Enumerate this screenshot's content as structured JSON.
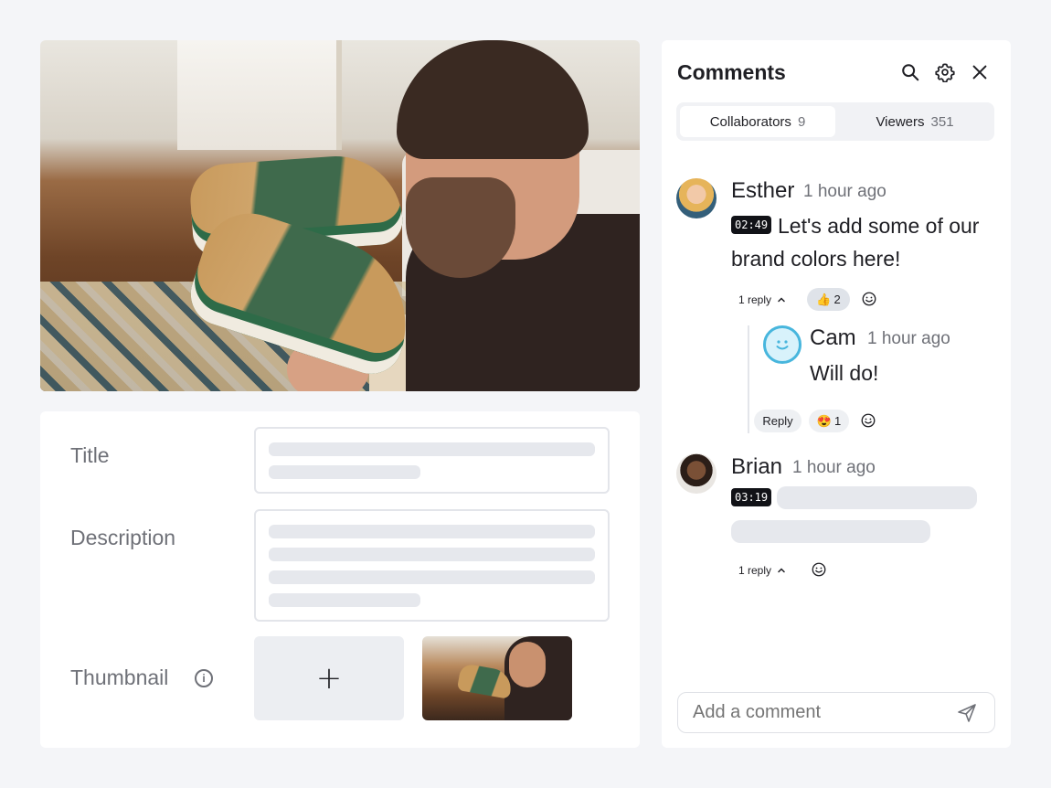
{
  "form": {
    "title_label": "Title",
    "description_label": "Description",
    "thumbnail_label": "Thumbnail",
    "add_thumbnail_symbol": "+",
    "info_symbol": "i"
  },
  "comments_panel": {
    "title": "Comments",
    "icons": [
      "search-icon",
      "gear-icon",
      "close-icon"
    ],
    "tabs": [
      {
        "label": "Collaborators",
        "count": "9",
        "active": true
      },
      {
        "label": "Viewers",
        "count": "351",
        "active": false
      }
    ],
    "comments": [
      {
        "author": "Esther",
        "time": "1 hour ago",
        "timestamp": "02:49",
        "text": "Let's add some of our brand colors here!",
        "replies_label": "1 reply",
        "reaction": {
          "emoji": "👍",
          "count": "2"
        },
        "replies": [
          {
            "author": "Cam",
            "time": "1 hour ago",
            "text": "Will do!",
            "reply_label": "Reply",
            "reaction": {
              "emoji": "😍",
              "count": "1"
            }
          }
        ]
      },
      {
        "author": "Brian",
        "time": "1 hour ago",
        "timestamp": "03:19",
        "replies_label": "1 reply"
      }
    ],
    "input_placeholder": "Add a comment"
  },
  "colors": {
    "background": "#f4f5f8",
    "panel": "#ffffff",
    "skeleton": "#e6e8ed",
    "timestamp_badge": "#111217",
    "cam_avatar_accent": "#48b6dd"
  }
}
